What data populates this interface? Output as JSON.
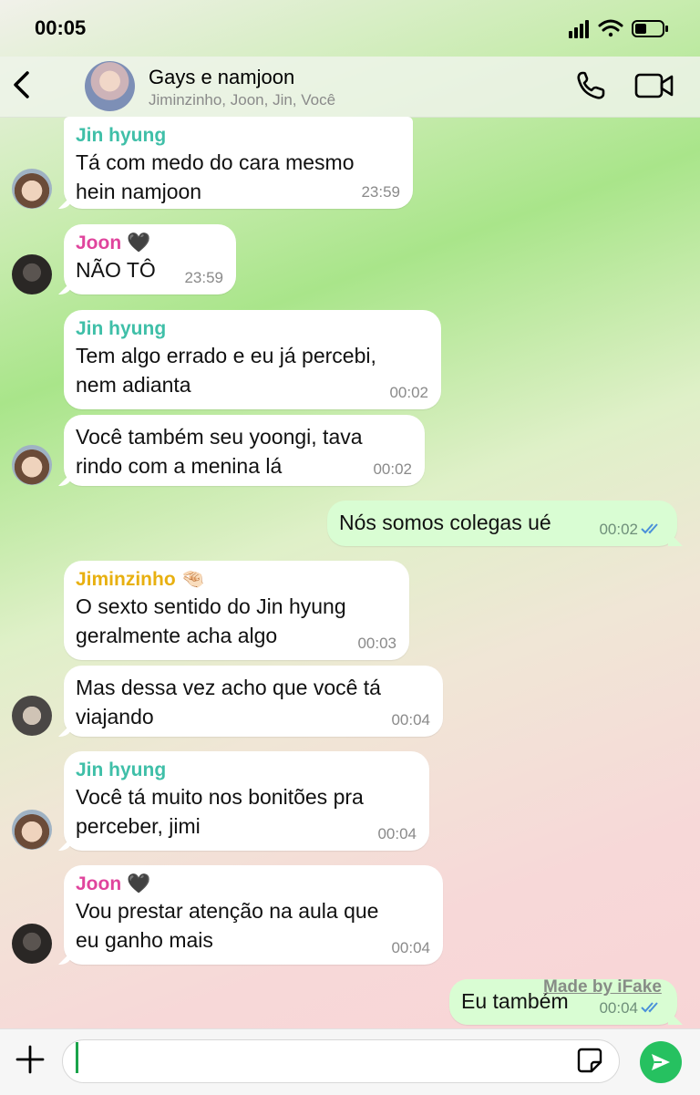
{
  "status_bar": {
    "time": "00:05"
  },
  "header": {
    "title": "Gays e namjoon",
    "members": "Jiminzinho, Joon, Jin, Você"
  },
  "messages": [
    {
      "sender": "Jin hyung",
      "text": "Tá com medo do cara mesmo\nhein namjoon",
      "time": "23:59"
    },
    {
      "sender": "Joon 🖤",
      "text": "NÃO TÔ",
      "time": "23:59"
    },
    {
      "sender": "Jin hyung",
      "text": "Tem algo errado e eu já percebi,\nnem adianta",
      "time": "00:02"
    },
    {
      "sender": "",
      "text": "Você também seu yoongi, tava\nrindo com a menina lá",
      "time": "00:02"
    },
    {
      "sender": "Você",
      "text": "Nós somos colegas ué",
      "time": "00:02"
    },
    {
      "sender": "Jiminzinho 🤏🏻",
      "text": "O sexto sentido do Jin hyung\ngeralmente acha algo",
      "time": "00:03"
    },
    {
      "sender": "",
      "text": "Mas dessa vez acho que você tá\nviajando",
      "time": "00:04"
    },
    {
      "sender": "Jin hyung",
      "text": "Você tá muito nos bonitões pra\nperceber, jimi",
      "time": "00:04"
    },
    {
      "sender": "Joon 🖤",
      "text": "Vou prestar atenção na aula que\neu ganho mais",
      "time": "00:04"
    },
    {
      "sender": "Você",
      "text": "Eu também",
      "time": "00:04"
    }
  ],
  "watermark": "Made by iFake",
  "composer": {
    "placeholder": ""
  },
  "colors": {
    "jin": "#3fbfa8",
    "joon": "#e0449d",
    "jimin": "#e8b010",
    "send": "#26c160",
    "read_ticks": "#4a90d9"
  },
  "icons": [
    "back-chevron-icon",
    "phone-icon",
    "video-camera-icon",
    "plus-icon",
    "sticker-icon",
    "send-icon",
    "double-check-icon"
  ]
}
